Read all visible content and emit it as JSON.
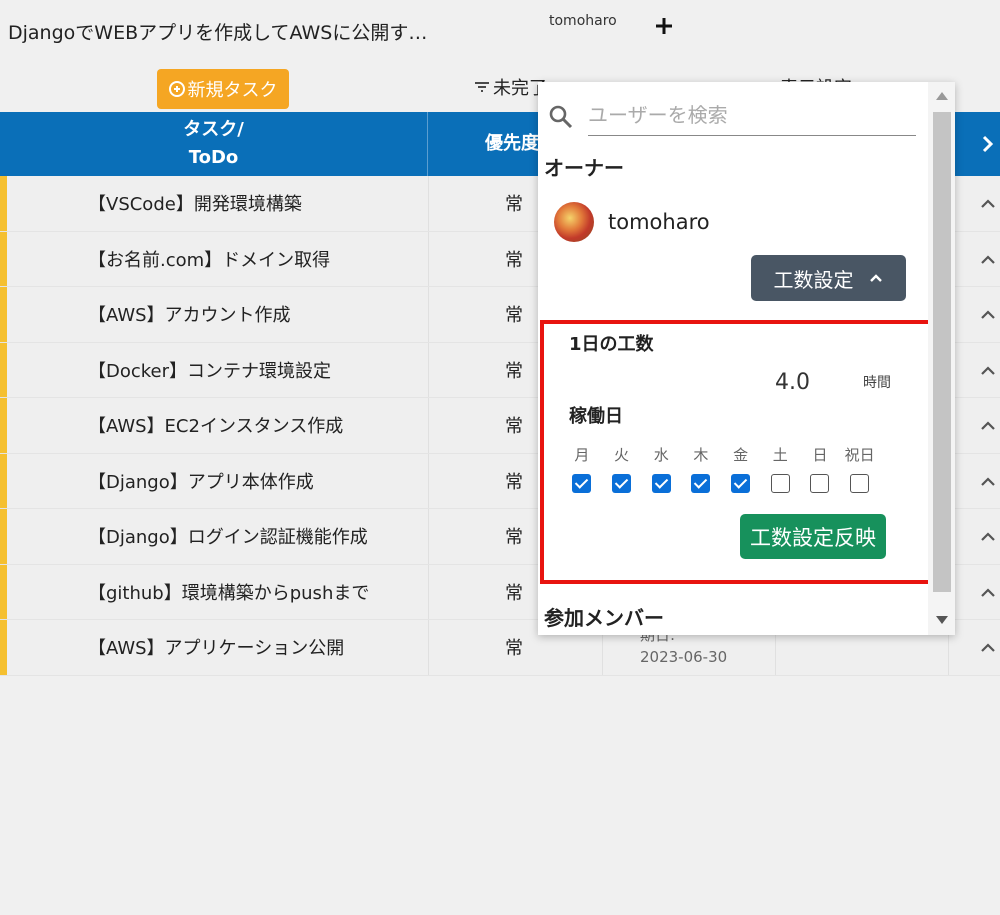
{
  "header": {
    "project_title": "DjangoでWEBアプリを作成してAWSに公開す…",
    "user_tab": "tomoharo",
    "add_icon": "plus-icon"
  },
  "toolbar": {
    "new_task_label": "新規タスク",
    "filter_label": "未完了",
    "display_setting_label": "表示設定"
  },
  "table": {
    "headers": {
      "task_line1": "タスク/",
      "task_line2": "ToDo",
      "priority": "優先度"
    },
    "rows": [
      {
        "name": "【VSCode】開発環境構築",
        "priority": "常"
      },
      {
        "name": "【お名前.com】ドメイン取得",
        "priority": "常"
      },
      {
        "name": "【AWS】アカウント作成",
        "priority": "常"
      },
      {
        "name": "【Docker】コンテナ環境設定",
        "priority": "常"
      },
      {
        "name": "【AWS】EC2インスタンス作成",
        "priority": "常"
      },
      {
        "name": "【Django】アプリ本体作成",
        "priority": "常"
      },
      {
        "name": "【Django】ログイン認証機能作成",
        "priority": "常"
      },
      {
        "name": "【github】環境構築からpushまで",
        "priority": "常"
      },
      {
        "name": "【AWS】アプリケーション公開",
        "priority": "常",
        "due_label": "期日:",
        "due_date": "2023-06-30"
      }
    ],
    "accent_color": "#f5c030",
    "header_color": "#0a6fb8"
  },
  "panel": {
    "search_placeholder": "ユーザーを検索",
    "owner_label": "オーナー",
    "owner_name": "tomoharo",
    "effort_button_label": "工数設定",
    "daily_effort_label": "1日の工数",
    "daily_hours": "4.0",
    "hours_unit": "時間",
    "workdays_label": "稼働日",
    "days": [
      {
        "name": "月",
        "checked": true
      },
      {
        "name": "火",
        "checked": true
      },
      {
        "name": "水",
        "checked": true
      },
      {
        "name": "木",
        "checked": true
      },
      {
        "name": "金",
        "checked": true
      },
      {
        "name": "土",
        "checked": false
      },
      {
        "name": "日",
        "checked": false
      },
      {
        "name": "祝日",
        "checked": false
      }
    ],
    "apply_button_label": "工数設定反映",
    "members_label": "参加メンバー",
    "highlight_color": "#e8140f",
    "apply_color": "#17915c",
    "effort_btn_color": "#495664"
  }
}
